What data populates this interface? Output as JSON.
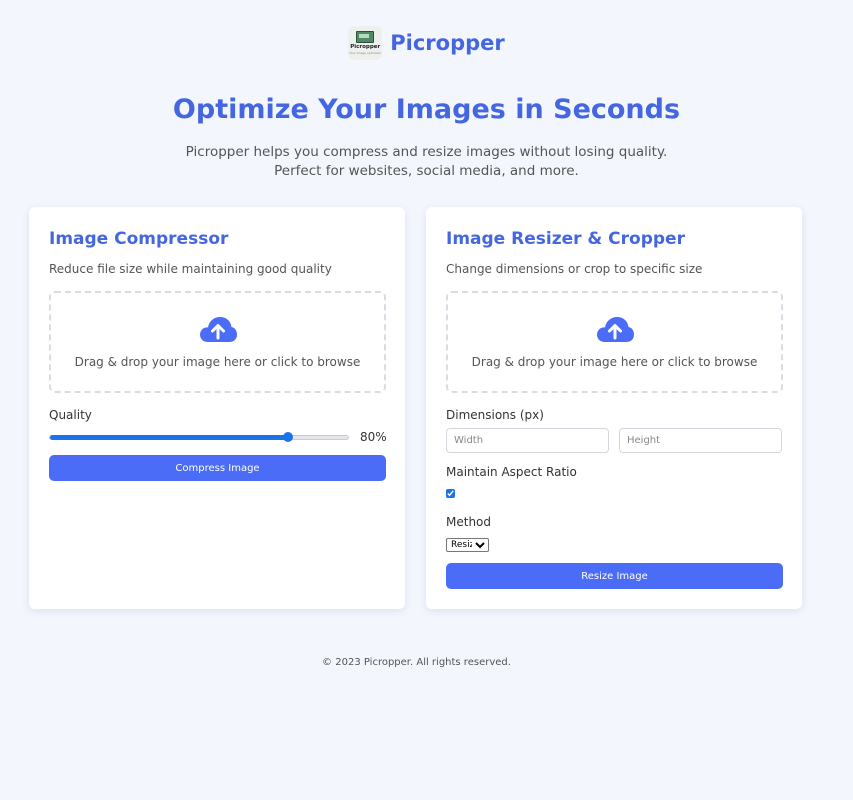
{
  "brand": {
    "name": "Picropper",
    "logo_text": "Picropper",
    "logo_sub": "Your image optimizer"
  },
  "hero": {
    "title": "Optimize Your Images in Seconds",
    "subtitle_line1": "Picropper helps you compress and resize images without losing quality.",
    "subtitle_line2": "Perfect for websites, social media, and more."
  },
  "compressor": {
    "title": "Image Compressor",
    "description": "Reduce file size while maintaining good quality",
    "dropzone_text": "Drag & drop your image here or click to browse",
    "quality_label": "Quality",
    "quality_value": 80,
    "quality_display": "80%",
    "button_label": "Compress Image"
  },
  "resizer": {
    "title": "Image Resizer & Cropper",
    "description": "Change dimensions or crop to specific size",
    "dropzone_text": "Drag & drop your image here or click to browse",
    "dimensions_label": "Dimensions (px)",
    "width_placeholder": "Width",
    "height_placeholder": "Height",
    "width_value": "",
    "height_value": "",
    "aspect_label": "Maintain Aspect Ratio",
    "aspect_checked": true,
    "method_label": "Method",
    "method_selected": "Resize",
    "button_label": "Resize Image"
  },
  "footer": {
    "text": "© 2023 Picropper. All rights reserved."
  },
  "colors": {
    "accent": "#4466e0",
    "button": "#4a6cf7",
    "slider": "#1a73e8",
    "background": "#f3f6fd"
  },
  "icons": {
    "dropzone": "cloud-upload-icon"
  }
}
